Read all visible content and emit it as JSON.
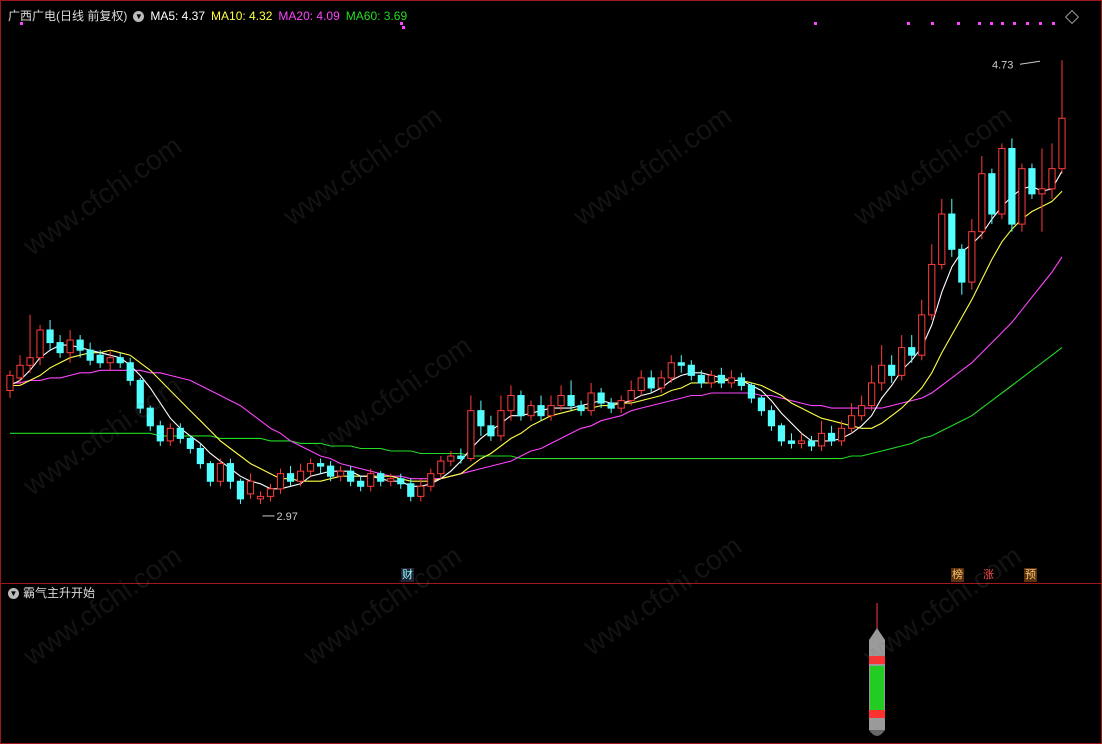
{
  "header": {
    "stock_title": "广西广电(日线 前复权)",
    "ma5_label": "MA5: 4.37",
    "ma10_label": "MA10: 4.32",
    "ma20_label": "MA20: 4.09",
    "ma60_label": "MA60: 3.69"
  },
  "colors": {
    "up": "#ff3c3c",
    "down": "#54ffff",
    "ma5": "#ffffff",
    "ma10": "#ffff44",
    "ma20": "#ff44ff",
    "ma60": "#22dd22",
    "frame": "#a01818"
  },
  "indicator": {
    "title": "霸气主升开始"
  },
  "markers": {
    "cai": "财",
    "bang": "榜",
    "zhang": "涨",
    "yu": "预"
  },
  "watermark": "www.cfchi.com",
  "chart_data": {
    "type": "candlestick",
    "ylim": [
      2.7,
      4.85
    ],
    "annotations": [
      {
        "text": "2.97",
        "bar": 25,
        "value": 2.97
      },
      {
        "text": "4.73",
        "bar": 103,
        "value": 4.73
      }
    ],
    "candles": [
      [
        3.42,
        3.48,
        3.39,
        3.5
      ],
      [
        3.47,
        3.52,
        3.44,
        3.56
      ],
      [
        3.52,
        3.55,
        3.49,
        3.72
      ],
      [
        3.55,
        3.66,
        3.52,
        3.68
      ],
      [
        3.66,
        3.61,
        3.58,
        3.7
      ],
      [
        3.61,
        3.57,
        3.55,
        3.64
      ],
      [
        3.57,
        3.62,
        3.53,
        3.66
      ],
      [
        3.62,
        3.58,
        3.55,
        3.64
      ],
      [
        3.58,
        3.54,
        3.52,
        3.61
      ],
      [
        3.56,
        3.53,
        3.51,
        3.58
      ],
      [
        3.53,
        3.55,
        3.5,
        3.58
      ],
      [
        3.55,
        3.53,
        3.51,
        3.57
      ],
      [
        3.53,
        3.46,
        3.44,
        3.55
      ],
      [
        3.46,
        3.35,
        3.33,
        3.47
      ],
      [
        3.35,
        3.28,
        3.26,
        3.36
      ],
      [
        3.28,
        3.22,
        3.2,
        3.3
      ],
      [
        3.22,
        3.27,
        3.2,
        3.29
      ],
      [
        3.27,
        3.23,
        3.21,
        3.29
      ],
      [
        3.23,
        3.19,
        3.17,
        3.24
      ],
      [
        3.19,
        3.13,
        3.11,
        3.21
      ],
      [
        3.13,
        3.06,
        3.04,
        3.14
      ],
      [
        3.06,
        3.13,
        3.04,
        3.15
      ],
      [
        3.13,
        3.06,
        3.03,
        3.15
      ],
      [
        3.06,
        2.99,
        2.97,
        3.07
      ],
      [
        3.01,
        3.06,
        2.99,
        3.09
      ],
      [
        2.99,
        3.0,
        2.97,
        3.02
      ],
      [
        3.0,
        3.03,
        2.98,
        3.05
      ],
      [
        3.03,
        3.09,
        3.01,
        3.11
      ],
      [
        3.09,
        3.06,
        3.04,
        3.12
      ],
      [
        3.06,
        3.1,
        3.04,
        3.13
      ],
      [
        3.1,
        3.13,
        3.08,
        3.15
      ],
      [
        3.13,
        3.12,
        3.09,
        3.15
      ],
      [
        3.12,
        3.08,
        3.06,
        3.14
      ],
      [
        3.08,
        3.1,
        3.06,
        3.12
      ],
      [
        3.1,
        3.06,
        3.04,
        3.12
      ],
      [
        3.06,
        3.04,
        3.02,
        3.08
      ],
      [
        3.04,
        3.09,
        3.02,
        3.11
      ],
      [
        3.09,
        3.06,
        3.04,
        3.1
      ],
      [
        3.06,
        3.07,
        3.04,
        3.09
      ],
      [
        3.07,
        3.05,
        3.03,
        3.09
      ],
      [
        3.05,
        3.0,
        2.98,
        3.07
      ],
      [
        3.0,
        3.04,
        2.98,
        3.07
      ],
      [
        3.04,
        3.09,
        3.02,
        3.11
      ],
      [
        3.09,
        3.14,
        3.07,
        3.16
      ],
      [
        3.14,
        3.16,
        3.12,
        3.18
      ],
      [
        3.16,
        3.15,
        3.13,
        3.19
      ],
      [
        3.15,
        3.34,
        3.14,
        3.4
      ],
      [
        3.34,
        3.28,
        3.24,
        3.38
      ],
      [
        3.28,
        3.24,
        3.22,
        3.32
      ],
      [
        3.24,
        3.34,
        3.22,
        3.4
      ],
      [
        3.34,
        3.4,
        3.3,
        3.44
      ],
      [
        3.4,
        3.32,
        3.3,
        3.42
      ],
      [
        3.32,
        3.36,
        3.3,
        3.38
      ],
      [
        3.36,
        3.32,
        3.3,
        3.4
      ],
      [
        3.32,
        3.36,
        3.3,
        3.4
      ],
      [
        3.36,
        3.4,
        3.34,
        3.44
      ],
      [
        3.4,
        3.36,
        3.34,
        3.46
      ],
      [
        3.36,
        3.34,
        3.32,
        3.38
      ],
      [
        3.34,
        3.41,
        3.32,
        3.45
      ],
      [
        3.41,
        3.37,
        3.35,
        3.43
      ],
      [
        3.37,
        3.35,
        3.33,
        3.39
      ],
      [
        3.35,
        3.38,
        3.33,
        3.4
      ],
      [
        3.38,
        3.42,
        3.36,
        3.46
      ],
      [
        3.42,
        3.47,
        3.4,
        3.5
      ],
      [
        3.47,
        3.43,
        3.41,
        3.5
      ],
      [
        3.43,
        3.47,
        3.41,
        3.5
      ],
      [
        3.47,
        3.53,
        3.45,
        3.56
      ],
      [
        3.53,
        3.52,
        3.49,
        3.56
      ],
      [
        3.52,
        3.48,
        3.46,
        3.54
      ],
      [
        3.48,
        3.45,
        3.43,
        3.5
      ],
      [
        3.45,
        3.48,
        3.43,
        3.5
      ],
      [
        3.48,
        3.45,
        3.43,
        3.51
      ],
      [
        3.45,
        3.47,
        3.43,
        3.5
      ],
      [
        3.47,
        3.44,
        3.42,
        3.49
      ],
      [
        3.44,
        3.39,
        3.37,
        3.45
      ],
      [
        3.39,
        3.34,
        3.32,
        3.4
      ],
      [
        3.34,
        3.28,
        3.26,
        3.36
      ],
      [
        3.28,
        3.22,
        3.2,
        3.29
      ],
      [
        3.22,
        3.21,
        3.19,
        3.25
      ],
      [
        3.21,
        3.22,
        3.19,
        3.25
      ],
      [
        3.22,
        3.2,
        3.18,
        3.24
      ],
      [
        3.2,
        3.25,
        3.18,
        3.3
      ],
      [
        3.25,
        3.22,
        3.2,
        3.28
      ],
      [
        3.22,
        3.27,
        3.2,
        3.3
      ],
      [
        3.27,
        3.32,
        3.25,
        3.37
      ],
      [
        3.32,
        3.36,
        3.3,
        3.4
      ],
      [
        3.36,
        3.45,
        3.34,
        3.52
      ],
      [
        3.45,
        3.52,
        3.42,
        3.6
      ],
      [
        3.52,
        3.48,
        3.45,
        3.56
      ],
      [
        3.48,
        3.59,
        3.46,
        3.64
      ],
      [
        3.59,
        3.56,
        3.53,
        3.64
      ],
      [
        3.56,
        3.72,
        3.54,
        3.78
      ],
      [
        3.72,
        3.92,
        3.7,
        4.0
      ],
      [
        3.92,
        4.12,
        3.9,
        4.18
      ],
      [
        4.12,
        3.98,
        3.95,
        4.18
      ],
      [
        3.98,
        3.85,
        3.8,
        4.0
      ],
      [
        3.85,
        4.05,
        3.82,
        4.1
      ],
      [
        4.05,
        4.28,
        4.02,
        4.35
      ],
      [
        4.28,
        4.12,
        4.08,
        4.3
      ],
      [
        4.12,
        4.38,
        4.1,
        4.4
      ],
      [
        4.38,
        4.08,
        4.05,
        4.42
      ],
      [
        4.08,
        4.3,
        4.05,
        4.32
      ],
      [
        4.3,
        4.2,
        4.18,
        4.32
      ],
      [
        4.2,
        4.22,
        4.05,
        4.38
      ],
      [
        4.22,
        4.3,
        4.18,
        4.4
      ],
      [
        4.3,
        4.5,
        4.28,
        4.73
      ]
    ],
    "ma5": [
      3.44,
      3.46,
      3.5,
      3.55,
      3.58,
      3.6,
      3.6,
      3.59,
      3.58,
      3.57,
      3.56,
      3.55,
      3.52,
      3.48,
      3.43,
      3.37,
      3.31,
      3.27,
      3.24,
      3.21,
      3.17,
      3.14,
      3.11,
      3.08,
      3.06,
      3.05,
      3.03,
      3.03,
      3.04,
      3.05,
      3.08,
      3.09,
      3.1,
      3.1,
      3.1,
      3.08,
      3.08,
      3.07,
      3.06,
      3.06,
      3.04,
      3.04,
      3.05,
      3.07,
      3.1,
      3.14,
      3.19,
      3.23,
      3.26,
      3.29,
      3.32,
      3.32,
      3.33,
      3.34,
      3.35,
      3.35,
      3.35,
      3.36,
      3.37,
      3.38,
      3.37,
      3.37,
      3.38,
      3.4,
      3.41,
      3.43,
      3.46,
      3.48,
      3.49,
      3.49,
      3.48,
      3.47,
      3.46,
      3.46,
      3.44,
      3.42,
      3.38,
      3.33,
      3.29,
      3.25,
      3.22,
      3.22,
      3.22,
      3.23,
      3.25,
      3.28,
      3.32,
      3.39,
      3.44,
      3.5,
      3.54,
      3.59,
      3.68,
      3.81,
      3.91,
      3.97,
      4.0,
      4.04,
      4.1,
      4.15,
      4.19,
      4.22,
      4.23,
      4.21,
      4.22,
      4.29
    ],
    "ma10": [
      3.44,
      3.44,
      3.46,
      3.48,
      3.51,
      3.53,
      3.55,
      3.56,
      3.57,
      3.57,
      3.58,
      3.57,
      3.56,
      3.53,
      3.5,
      3.46,
      3.42,
      3.38,
      3.34,
      3.3,
      3.26,
      3.22,
      3.19,
      3.16,
      3.13,
      3.11,
      3.09,
      3.07,
      3.07,
      3.06,
      3.06,
      3.06,
      3.07,
      3.08,
      3.08,
      3.08,
      3.08,
      3.08,
      3.08,
      3.07,
      3.06,
      3.06,
      3.06,
      3.07,
      3.08,
      3.09,
      3.12,
      3.15,
      3.17,
      3.2,
      3.23,
      3.25,
      3.28,
      3.3,
      3.32,
      3.33,
      3.34,
      3.35,
      3.35,
      3.36,
      3.36,
      3.37,
      3.37,
      3.38,
      3.39,
      3.4,
      3.42,
      3.43,
      3.45,
      3.45,
      3.45,
      3.46,
      3.46,
      3.46,
      3.45,
      3.44,
      3.42,
      3.4,
      3.37,
      3.35,
      3.33,
      3.31,
      3.3,
      3.29,
      3.28,
      3.27,
      3.27,
      3.29,
      3.32,
      3.35,
      3.39,
      3.43,
      3.49,
      3.57,
      3.64,
      3.71,
      3.78,
      3.86,
      3.94,
      4.01,
      4.06,
      4.1,
      4.13,
      4.15,
      4.17,
      4.21
    ],
    "ma20": [
      3.45,
      3.45,
      3.46,
      3.46,
      3.47,
      3.47,
      3.48,
      3.49,
      3.49,
      3.5,
      3.5,
      3.5,
      3.5,
      3.5,
      3.49,
      3.49,
      3.48,
      3.47,
      3.46,
      3.44,
      3.42,
      3.4,
      3.38,
      3.36,
      3.33,
      3.3,
      3.27,
      3.25,
      3.22,
      3.2,
      3.18,
      3.16,
      3.15,
      3.13,
      3.12,
      3.11,
      3.1,
      3.09,
      3.08,
      3.08,
      3.07,
      3.07,
      3.07,
      3.07,
      3.08,
      3.09,
      3.1,
      3.11,
      3.12,
      3.13,
      3.14,
      3.16,
      3.18,
      3.19,
      3.21,
      3.23,
      3.25,
      3.27,
      3.28,
      3.3,
      3.31,
      3.32,
      3.34,
      3.35,
      3.36,
      3.37,
      3.38,
      3.39,
      3.4,
      3.4,
      3.41,
      3.41,
      3.41,
      3.41,
      3.41,
      3.4,
      3.4,
      3.39,
      3.38,
      3.37,
      3.36,
      3.36,
      3.35,
      3.35,
      3.35,
      3.35,
      3.35,
      3.35,
      3.36,
      3.37,
      3.38,
      3.39,
      3.41,
      3.44,
      3.47,
      3.5,
      3.53,
      3.57,
      3.61,
      3.65,
      3.69,
      3.74,
      3.79,
      3.84,
      3.89,
      3.95
    ],
    "ma60": [
      3.25,
      3.25,
      3.25,
      3.25,
      3.25,
      3.25,
      3.25,
      3.25,
      3.25,
      3.25,
      3.25,
      3.25,
      3.25,
      3.25,
      3.25,
      3.24,
      3.24,
      3.24,
      3.24,
      3.24,
      3.24,
      3.23,
      3.23,
      3.23,
      3.23,
      3.23,
      3.22,
      3.22,
      3.22,
      3.21,
      3.21,
      3.21,
      3.2,
      3.2,
      3.2,
      3.19,
      3.19,
      3.19,
      3.18,
      3.18,
      3.18,
      3.17,
      3.17,
      3.17,
      3.17,
      3.17,
      3.16,
      3.16,
      3.16,
      3.16,
      3.16,
      3.15,
      3.15,
      3.15,
      3.15,
      3.15,
      3.15,
      3.15,
      3.15,
      3.15,
      3.15,
      3.15,
      3.15,
      3.15,
      3.15,
      3.15,
      3.15,
      3.15,
      3.15,
      3.15,
      3.15,
      3.15,
      3.15,
      3.15,
      3.15,
      3.15,
      3.15,
      3.15,
      3.15,
      3.15,
      3.15,
      3.15,
      3.15,
      3.15,
      3.16,
      3.16,
      3.17,
      3.18,
      3.19,
      3.2,
      3.21,
      3.23,
      3.24,
      3.26,
      3.28,
      3.3,
      3.32,
      3.35,
      3.38,
      3.41,
      3.44,
      3.47,
      3.5,
      3.53,
      3.56,
      3.59
    ]
  }
}
